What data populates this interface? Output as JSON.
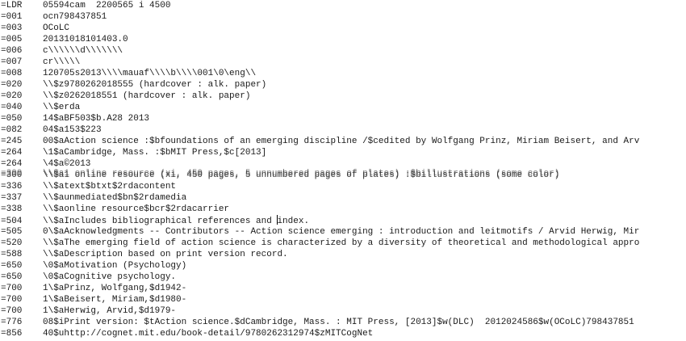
{
  "window": {
    "colors": {
      "background": "#ffffff",
      "text": "#1a1a1a"
    }
  },
  "record": {
    "lines": [
      {
        "tag": "=LDR",
        "text": "05594cam  2200565 i 4500"
      },
      {
        "tag": "=001",
        "text": "ocn798437851"
      },
      {
        "tag": "=003",
        "text": "OCoLC"
      },
      {
        "tag": "=005",
        "text": "20131018101403.0"
      },
      {
        "tag": "=006",
        "text": "c\\\\\\\\\\\\d\\\\\\\\\\\\\\"
      },
      {
        "tag": "=007",
        "text": "cr\\\\\\\\\\"
      },
      {
        "tag": "=008",
        "text": "120705s2013\\\\\\\\mauaf\\\\\\\\b\\\\\\\\001\\0\\eng\\\\"
      },
      {
        "tag": "=020",
        "text": "\\\\$z9780262018555 (hardcover : alk. paper)"
      },
      {
        "tag": "=020",
        "text": "\\\\$z0262018551 (hardcover : alk. paper)"
      },
      {
        "tag": "=040",
        "text": "\\\\$erda"
      },
      {
        "tag": "=050",
        "text": "14$aBF503$b.A28 2013"
      },
      {
        "tag": "=082",
        "text": "04$a153$223"
      },
      {
        "tag": "=245",
        "text": "00$aAction science :$bfoundations of an emerging discipline /$cedited by Wolfgang Prinz, Miriam Beisert, and Arv"
      },
      {
        "tag": "=264",
        "text": "\\1$aCambridge, Mass. :$bMIT Press,$c[2013]"
      },
      {
        "tag": "=264",
        "text": "\\4$a©2013"
      },
      {
        "tag": "=300",
        "text": "\\\\$a1 online resource (xi, 450 pages, 5 unnumbered pages of plates) :$billustrations (some color)"
      },
      {
        "tag": "=336",
        "text": "\\\\$atext$btxt$2rdacontent"
      },
      {
        "tag": "=337",
        "text": "\\\\$aunmediated$bn$2rdamedia"
      },
      {
        "tag": "=338",
        "text": "\\\\$aonline resource$bcr$2rdacarrier"
      },
      {
        "tag": "=504",
        "text_before_caret": "\\\\$aIncludes bibliographical references and ",
        "text_after_caret": "index."
      },
      {
        "tag": "=505",
        "text": "0\\$aAcknowledgments -- Contributors -- Action science emerging : introduction and leitmotifs / Arvid Herwig, Mir"
      },
      {
        "tag": "=520",
        "text": "\\\\$aThe emerging field of action science is characterized by a diversity of theoretical and methodological appro"
      },
      {
        "tag": "=588",
        "text": "\\\\$aDescription based on print version record."
      },
      {
        "tag": "=650",
        "text": "\\0$aMotivation (Psychology)"
      },
      {
        "tag": "=650",
        "text": "\\0$aCognitive psychology."
      },
      {
        "tag": "=700",
        "text": "1\\$aPrinz, Wolfgang,$d1942-"
      },
      {
        "tag": "=700",
        "text": "1\\$aBeisert, Miriam,$d1980-"
      },
      {
        "tag": "=700",
        "text": "1\\$aHerwig, Arvid,$d1979-"
      },
      {
        "tag": "=776",
        "text": "08$iPrint version: $tAction science.$dCambridge, Mass. : MIT Press, [2013]$w(DLC)  2012024586$w(OCoLC)798437851"
      },
      {
        "tag": "=856",
        "text": "40$uhttp://cognet.mit.edu/book-detail/9780262312974$zMITCogNet"
      }
    ]
  }
}
